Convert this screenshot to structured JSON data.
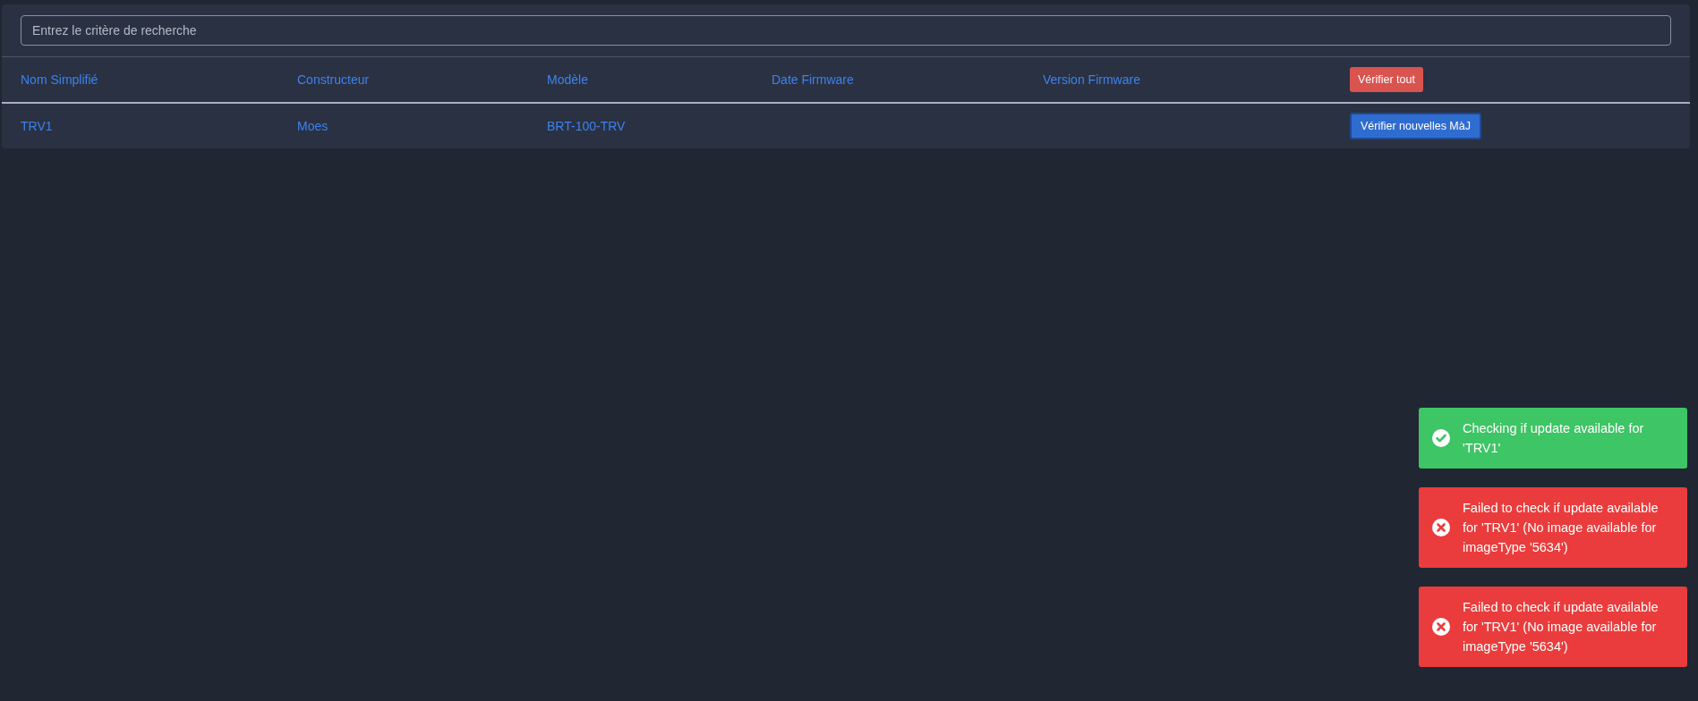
{
  "search": {
    "placeholder": "Entrez le critère de recherche"
  },
  "table": {
    "columns": [
      "Nom Simplifié",
      "Constructeur",
      "Modèle",
      "Date Firmware",
      "Version Firmware"
    ],
    "header_action": "Vérifier tout",
    "rows": [
      {
        "cells": [
          "TRV1",
          "Moes",
          "BRT-100-TRV",
          "",
          ""
        ],
        "action": "Vérifier nouvelles MàJ"
      }
    ]
  },
  "toasts": [
    {
      "kind": "success",
      "message": "Checking if update available for 'TRV1'"
    },
    {
      "kind": "error",
      "message": "Failed to check if update available for 'TRV1' (No image available for imageType '5634')"
    },
    {
      "kind": "error",
      "message": "Failed to check if update available for 'TRV1' (No image available for imageType '5634')"
    }
  ]
}
